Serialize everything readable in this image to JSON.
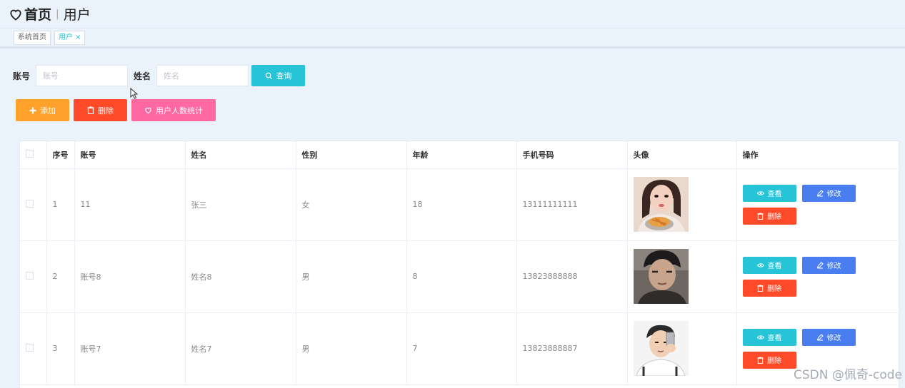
{
  "header": {
    "home_title": "首页",
    "separator": "|",
    "current_title": "用户"
  },
  "tags": [
    {
      "label": "系统首页",
      "active": false
    },
    {
      "label": "用户",
      "active": true,
      "close": "×"
    }
  ],
  "search": {
    "account_label": "账号",
    "account_placeholder": "账号",
    "account_value": "",
    "name_label": "姓名",
    "name_placeholder": "姓名",
    "name_value": "",
    "query_label": "查询"
  },
  "toolbar": {
    "add_label": "添加",
    "delete_label": "删除",
    "stats_label": "用户人数统计"
  },
  "table": {
    "headers": [
      "序号",
      "账号",
      "姓名",
      "性别",
      "年龄",
      "手机号码",
      "头像",
      "操作"
    ],
    "rows": [
      {
        "index": "1",
        "account": "11",
        "name": "张三",
        "gender": "女",
        "age": "18",
        "phone": "13111111111"
      },
      {
        "index": "2",
        "account": "账号8",
        "name": "姓名8",
        "gender": "男",
        "age": "8",
        "phone": "13823888888"
      },
      {
        "index": "3",
        "account": "账号7",
        "name": "姓名7",
        "gender": "男",
        "age": "7",
        "phone": "13823888887"
      }
    ],
    "actions": {
      "view": "查看",
      "edit": "修改",
      "delete": "删除"
    }
  },
  "watermark": "CSDN @佩奇-code",
  "colors": {
    "primary": "#27c3d6",
    "warning": "#ffa12b",
    "danger": "#ff4a2a",
    "pink": "#ff68a1",
    "blue": "#4a7ef0",
    "background": "#eaf2fb"
  },
  "icons": {
    "header": "heart-icon",
    "query": "search-icon",
    "add": "plus-icon",
    "delete": "trash-icon",
    "stats": "heart-icon",
    "view": "eye-icon",
    "edit": "pencil-icon"
  }
}
